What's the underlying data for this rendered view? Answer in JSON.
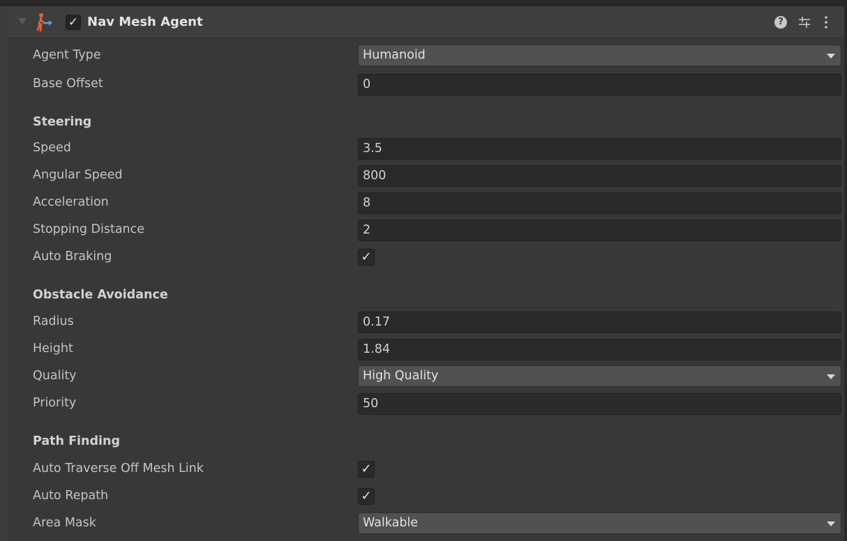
{
  "component": {
    "title": "Nav Mesh Agent",
    "enabled_check": "✓",
    "help_glyph": "?",
    "icons": [
      "foldout-arrow-icon",
      "nav-mesh-agent-icon",
      "help-icon",
      "preset-icon",
      "more-icon"
    ]
  },
  "fields": {
    "agent_type": {
      "label": "Agent Type",
      "value": "Humanoid"
    },
    "base_offset": {
      "label": "Base Offset",
      "value": "0"
    },
    "steering_header": "Steering",
    "speed": {
      "label": "Speed",
      "value": "3.5"
    },
    "angular_speed": {
      "label": "Angular Speed",
      "value": "800"
    },
    "acceleration": {
      "label": "Acceleration",
      "value": "8"
    },
    "stopping_distance": {
      "label": "Stopping Distance",
      "value": "2"
    },
    "auto_braking": {
      "label": "Auto Braking",
      "check": "✓"
    },
    "obstacle_header": "Obstacle Avoidance",
    "radius": {
      "label": "Radius",
      "value": "0.17"
    },
    "height": {
      "label": "Height",
      "value": "1.84"
    },
    "quality": {
      "label": "Quality",
      "value": "High Quality"
    },
    "priority": {
      "label": "Priority",
      "value": "50"
    },
    "pathfinding_header": "Path Finding",
    "auto_traverse": {
      "label": "Auto Traverse Off Mesh Link",
      "check": "✓"
    },
    "auto_repath": {
      "label": "Auto Repath",
      "check": "✓"
    },
    "area_mask": {
      "label": "Area Mask",
      "value": "Walkable"
    }
  },
  "colors": {
    "background": "#383838",
    "field_bg": "#2a2a2a",
    "dropdown_bg": "#515151",
    "icon_orange": "#e8642a",
    "icon_blue": "#4aa8e8"
  }
}
